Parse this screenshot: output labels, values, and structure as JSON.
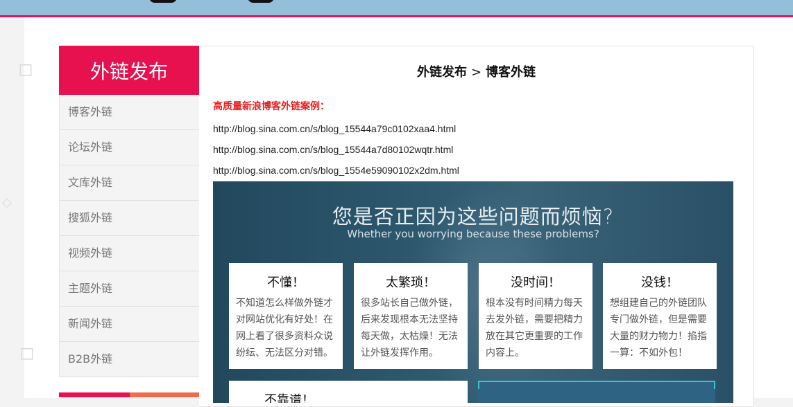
{
  "sidebar": {
    "title": "外链发布",
    "items": [
      {
        "label": "博客外链"
      },
      {
        "label": "论坛外链"
      },
      {
        "label": "文库外链"
      },
      {
        "label": "搜狐外链"
      },
      {
        "label": "视频外链"
      },
      {
        "label": "主题外链"
      },
      {
        "label": "新闻外链"
      },
      {
        "label": "B2B外链"
      }
    ]
  },
  "breadcrumb": {
    "parent": "外链发布",
    "separator": ">",
    "current": "博客外链"
  },
  "main": {
    "section_label": "高质量新浪博客外链案例：",
    "links": [
      "http://blog.sina.com.cn/s/blog_15544a79c0102xaa4.html",
      "http://blog.sina.com.cn/s/blog_15544a7d80102wqtr.html",
      "http://blog.sina.com.cn/s/blog_1554e59090102x2dm.html"
    ]
  },
  "banner": {
    "title": "您是否正因为这些问题而烦恼?",
    "subtitle": "Whether you worrying because these problems?",
    "cards": [
      {
        "title": "不懂！",
        "text": "不知道怎么样做外链才对网站优化有好处！在网上看了很多资料众说纷纭、无法区分对错。"
      },
      {
        "title": "太繁琐！",
        "text": "很多站长自己做外链，后来发现根本无法坚持每天做，太枯燥！无法让外链发挥作用。"
      },
      {
        "title": "没时间！",
        "text": "根本没有时间精力每天去发外链，需要把精力放在其它更重要的工作内容上。"
      },
      {
        "title": "没钱！",
        "text": "想组建自己的外链团队专门做外链，但是需要大量的财力物力！掐指一算：不如外包！"
      }
    ],
    "bottom_card_title": "不靠谱！"
  },
  "colors": {
    "accent": "#e8114f",
    "topbar": "#93bfdb",
    "banner": "#2a5066",
    "label_red": "#e81f1f"
  }
}
